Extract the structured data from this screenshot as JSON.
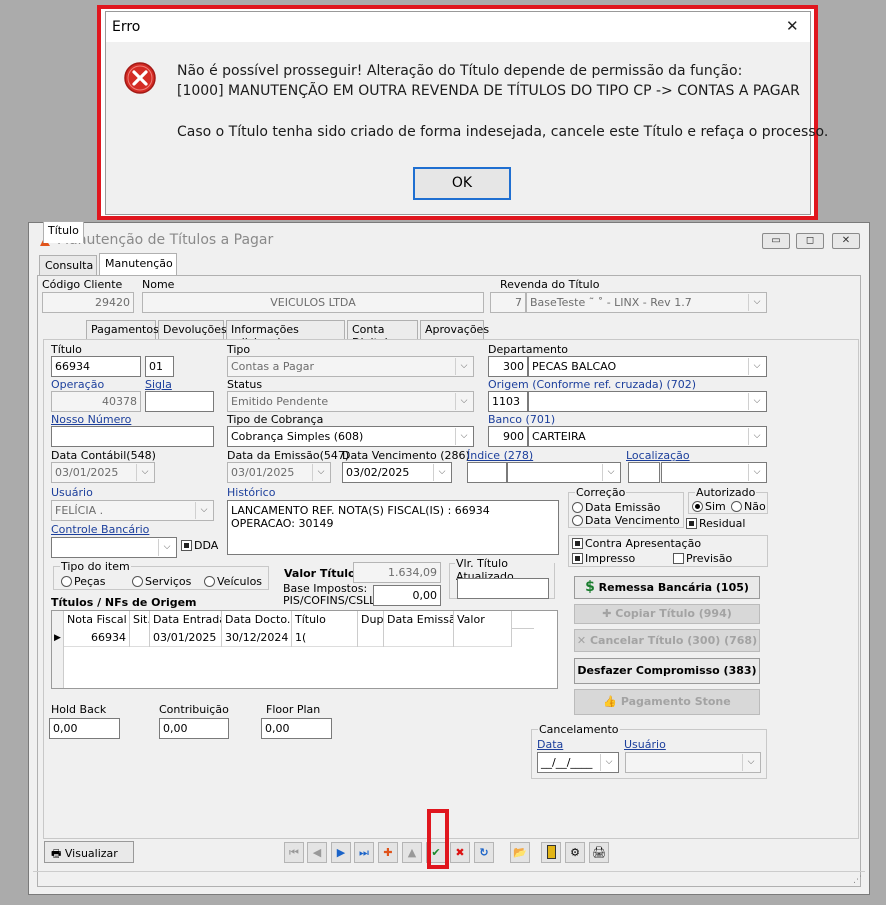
{
  "dialog": {
    "title": "Erro",
    "close_glyph": "✕",
    "line1": "Não é possível prosseguir! Alteração do Título depende de permissão da função:",
    "line2": "[1000] MANUTENÇÃO EM OUTRA REVENDA DE TÍTULOS DO TIPO CP -> CONTAS A PAGAR",
    "line3": "Caso o Título tenha sido criado de forma indesejada, cancele este Título e refaça o processo.",
    "ok_label": "OK",
    "icon": "error-icon"
  },
  "window": {
    "title": "Manutenção de Títulos a Pagar",
    "tabs": [
      "Consulta",
      "Manutenção"
    ],
    "codigo_cliente_label": "Código Cliente",
    "codigo_cliente": "29420",
    "nome_label": "Nome",
    "nome": "VEICULOS LTDA",
    "revenda_label": "Revenda do Título",
    "revenda_num": "7",
    "revenda_nome": "BaseTeste  ˜    ˚  - LINX - Rev 1.7",
    "subtabs": [
      "Título",
      "Pagamentos",
      "Devoluções",
      "Informações adicionais",
      "Conta Digital",
      "Aprovações"
    ]
  },
  "form": {
    "titulo_label": "Título",
    "titulo": "66934",
    "titulo_seq": "01",
    "tipo_label": "Tipo",
    "tipo": "Contas a Pagar",
    "departamento_label": "Departamento",
    "dep_cod": "300",
    "dep_nome": "PECAS BALCAO",
    "operacao_label": "Operação",
    "operacao": "40378",
    "sigla_label": "Sigla",
    "sigla": "",
    "status_label": "Status",
    "status": "Emitido Pendente",
    "origem_label": "Origem (Conforme ref. cruzada) (702)",
    "origem_cod": "1103",
    "origem_nome": "",
    "nosso_numero_label": "Nosso Número",
    "nosso_numero": "",
    "tipo_cobranca_label": "Tipo de Cobrança",
    "tipo_cobranca": "Cobrança Simples (608)",
    "banco_label": "Banco (701)",
    "banco_cod": "900",
    "banco_nome": "CARTEIRA",
    "data_contabil_label": "Data Contábil(548)",
    "data_contabil": "03/01/2025",
    "data_emissao_label": "Data da Emissão(547)",
    "data_emissao": "03/01/2025",
    "data_venc_label": "Data Vencimento (286)",
    "data_venc": "03/02/2025",
    "indice_label": "Índice (278)",
    "localizacao_label": "Localização",
    "usuario_label": "Usuário",
    "usuario": "FELÍCIA .",
    "historico_label": "Histórico",
    "historico": "LANCAMENTO REF. NOTA(S) FISCAL(IS) : 66934 OPERACAO: 30149",
    "correcao_label": "Correção",
    "correcao_opts": [
      "Data Emissão",
      "Data Vencimento"
    ],
    "autorizado_label": "Autorizado",
    "autorizado_opts": [
      "Sim",
      "Não"
    ],
    "residual_label": "Residual",
    "controle_bancario_label": "Controle Bancário",
    "dda_label": "DDA",
    "contra_apresentacao_label": "Contra Apresentação",
    "impresso_label": "Impresso",
    "previsao_label": "Previsão",
    "tipo_item_label": "Tipo do item",
    "tipo_item_opts": [
      "Peças",
      "Serviços",
      "Veículos"
    ],
    "valor_titulo_label": "Valor Título",
    "valor_titulo": "1.634,09",
    "base_impostos_label1": "Base Impostos:",
    "base_impostos_label2": "PIS/COFINS/CSLL",
    "base_impostos": "0,00",
    "vlr_atualizado_label": "Vlr. Título Atualizado",
    "vlr_atualizado": "",
    "titulos_nfs_label": "Títulos / NFs de Origem"
  },
  "grid": {
    "headers": [
      "Nota Fiscal",
      "Sit.",
      "Data Entrada",
      "Data Docto.",
      "Título",
      "Dup",
      "Data Emissão",
      "Valor"
    ],
    "rows": [
      [
        "66934",
        "",
        "03/01/2025",
        "30/12/2024",
        "1(",
        "",
        "",
        ""
      ]
    ]
  },
  "buttons": {
    "remessa": "Remessa Bancária (105)",
    "copiar": "Copiar Título (994)",
    "cancelar": "Cancelar Título (300) (768)",
    "desfazer": "Desfazer Compromisso (383)",
    "pagamento": "Pagamento Stone",
    "visualizar": "Visualizar"
  },
  "bottom": {
    "hold_back_label": "Hold Back",
    "hold_back": "0,00",
    "contribuicao_label": "Contribuição",
    "contribuicao": "0,00",
    "floor_plan_label": "Floor Plan",
    "floor_plan": "0,00",
    "cancelamento_label": "Cancelamento",
    "cancel_data_label": "Data",
    "cancel_data": "__/__/____",
    "cancel_usuario_label": "Usuário"
  },
  "colors": {
    "highlight": "#e0161e",
    "label_blue": "#1c3f9c",
    "ok_border": "#1f6fd1"
  }
}
